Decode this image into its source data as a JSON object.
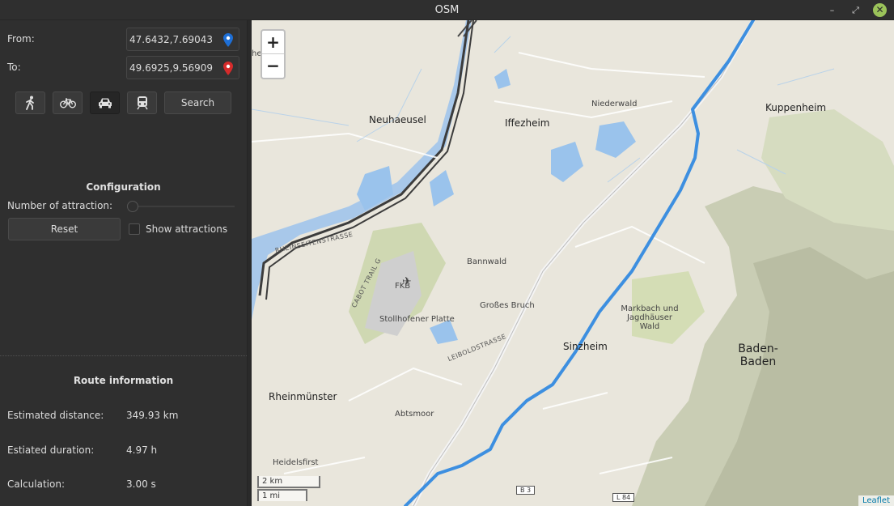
{
  "window": {
    "title": "OSM"
  },
  "form": {
    "from_label": "From:",
    "from_value": "47.6432,7.69043",
    "to_label": "To:",
    "to_value": "49.6925,9.56909",
    "search_label": "Search"
  },
  "config": {
    "title": "Configuration",
    "attraction_label": "Number of attraction:",
    "attraction_value": 0,
    "reset_label": "Reset",
    "show_attractions_label": "Show attractions",
    "show_attractions_checked": false
  },
  "route": {
    "title": "Route information",
    "distance_label": "Estimated distance:",
    "distance_value": "349.93 km",
    "duration_label": "Estiated duration:",
    "duration_value": "4.97 h",
    "calc_label": "Calculation:",
    "calc_value": "3.00 s"
  },
  "map": {
    "labels": {
      "neuhaeusel": "Neuhaeusel",
      "iffezheim": "Iffezheim",
      "niederwald": "Niederwald",
      "kuppenheim": "Kuppenheim",
      "bannwald": "Bannwald",
      "fkb": "FKB",
      "stollhofener": "Stollhofener Platte",
      "grosses_bruch": "Großes Bruch",
      "markbach": "Markbach und Jagdhäuser Wald",
      "sinzheim": "Sinzheim",
      "baden": "Baden-Baden",
      "rheinmuenster": "Rheinmünster",
      "abtsmoor": "Abtsmoor",
      "heidelsfirst": "Heidelsfirst",
      "rheinseitenstrasse": "RHEINSEITENSTRASSE",
      "cabot_trail": "CABOT TRAIL G",
      "leiboldstrasse": "LEIBOLDSTRASSE",
      "edge_he": "he",
      "b3": "B 3",
      "l84": "L 84"
    },
    "zoom_in": "+",
    "zoom_out": "−",
    "scale_km": "2 km",
    "scale_mi": "1 mi",
    "attribution": "Leaflet",
    "route_color": "#3d8fe0"
  },
  "icons": {
    "walk": "walk-icon",
    "bike": "bike-icon",
    "car": "car-icon",
    "transit": "train-icon",
    "from_pin": "blue-pin-icon",
    "to_pin": "red-pin-icon"
  }
}
